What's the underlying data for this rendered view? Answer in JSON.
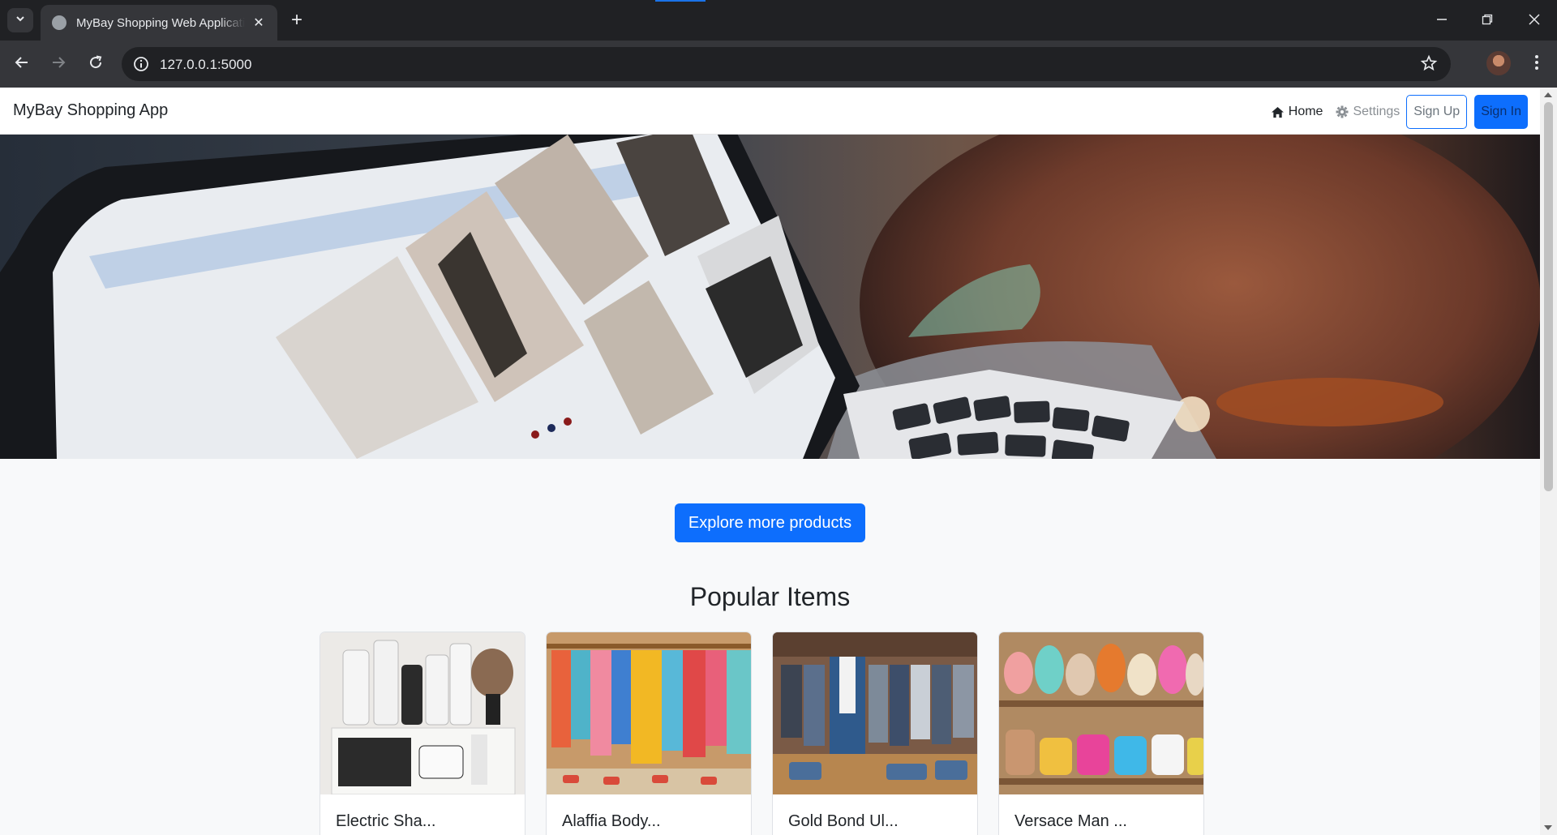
{
  "browser": {
    "tab_title": "MyBay Shopping Web Application",
    "url": "127.0.0.1:5000"
  },
  "navbar": {
    "brand": "MyBay Shopping App",
    "home_label": "Home",
    "settings_label": "Settings",
    "signup_label": "Sign Up",
    "signin_label": "Sign In"
  },
  "hero": {
    "image_icon": "laptop-shopping-photo"
  },
  "main": {
    "explore_label": "Explore more products",
    "section_title": "Popular Items",
    "items": [
      {
        "title": "Electric Sha...",
        "image_icon": "grooming-products-photo"
      },
      {
        "title": "Alaffia Body...",
        "image_icon": "clothing-rack-photo"
      },
      {
        "title": "Gold Bond Ul...",
        "image_icon": "menswear-rack-photo"
      },
      {
        "title": "Versace Man ...",
        "image_icon": "shoe-shelf-photo"
      }
    ]
  },
  "colors": {
    "primary": "#0d6efd",
    "chrome_dark": "#202124",
    "page_bg": "#f8f9fa"
  }
}
